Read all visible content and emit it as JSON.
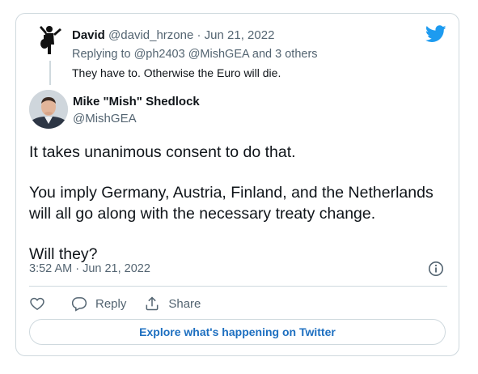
{
  "parent_tweet": {
    "author_name": "David",
    "author_handle": "@david_hrzone",
    "separator": "·",
    "date": "Jun 21, 2022",
    "replying_prefix": "Replying to",
    "replying_to": "@ph2403 @MishGEA",
    "replying_suffix": "and 3 others",
    "text": "They have to. Otherwise the Euro will die."
  },
  "tweet": {
    "author_name": "Mike \"Mish\" Shedlock",
    "author_handle": "@MishGEA",
    "paragraphs": [
      "It takes unanimous consent to do that.",
      "You imply Germany, Austria, Finland, and the Netherlands",
      "will all go along with the necessary treaty change.",
      "Will they?"
    ],
    "timestamp": "3:52 AM · Jun 21, 2022"
  },
  "actions": {
    "reply_label": "Reply",
    "share_label": "Share"
  },
  "cta": {
    "explore_label": "Explore what's happening on Twitter"
  },
  "icons": {
    "brand": "twitter-bird-icon",
    "like": "heart-icon",
    "reply": "reply-bubble-icon",
    "share": "share-icon",
    "info": "info-icon"
  },
  "colors": {
    "twitter_blue": "#1d9bf0",
    "link_blue": "#1d6fc0",
    "muted": "#536471",
    "border": "#cfd9de"
  }
}
